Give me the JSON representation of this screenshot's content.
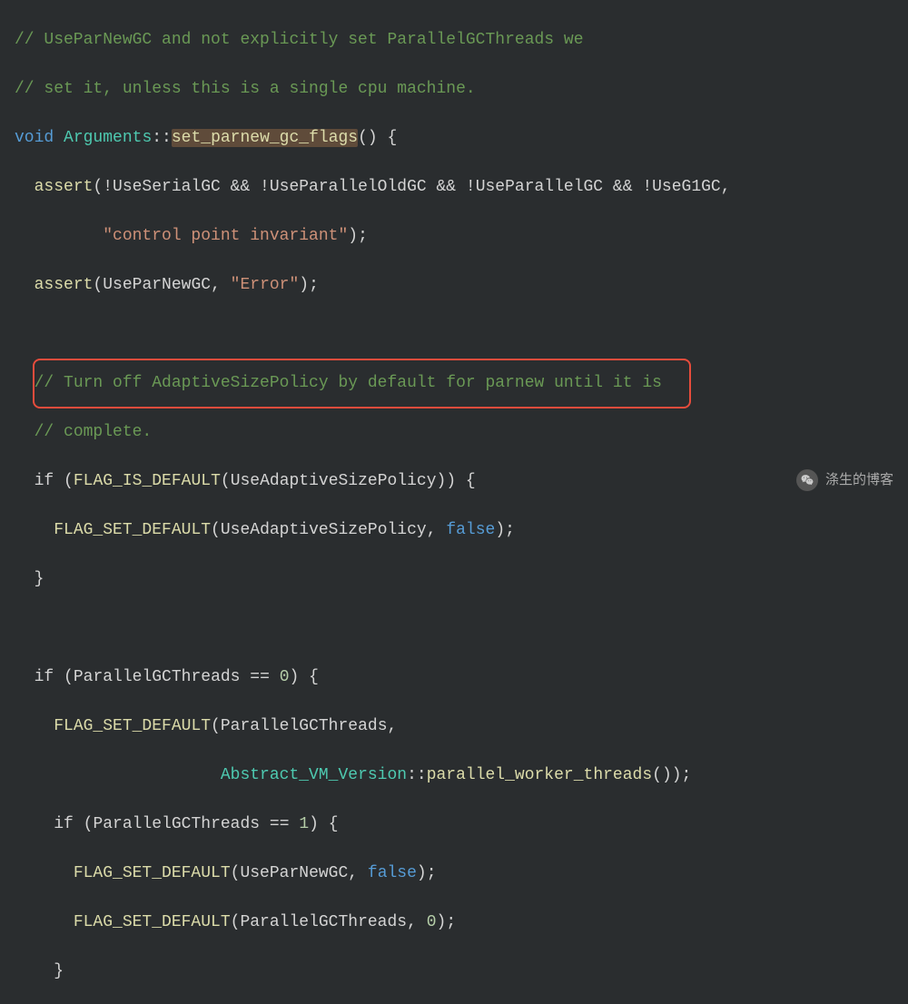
{
  "code": {
    "line1_comment": "// UseParNewGC and not explicitly set ParallelGCThreads we",
    "line2_comment": "// set it, unless this is a single cpu machine.",
    "line3_void": "void",
    "line3_class": "Arguments",
    "line3_method": "set_parnew_gc_flags",
    "line4_assert": "assert",
    "line4_expr": "(!UseSerialGC && !UseParallelOldGC && !UseParallelGC && !UseG1GC,",
    "line5_string": "\"control point invariant\"",
    "line6_assert": "assert",
    "line6_arg1": "UseParNewGC",
    "line6_string": "\"Error\"",
    "line8_comment": "// Turn off AdaptiveSizePolicy by default for parnew until it is",
    "line9_comment": "// complete.",
    "line10_if": "if",
    "line10_macro": "FLAG_IS_DEFAULT",
    "line10_arg": "UseAdaptiveSizePolicy",
    "line11_macro": "FLAG_SET_DEFAULT",
    "line11_arg": "UseAdaptiveSizePolicy",
    "line11_false": "false",
    "line14_if": "if",
    "line14_var": "ParallelGCThreads",
    "line14_zero": "0",
    "line15_macro": "FLAG_SET_DEFAULT",
    "line15_arg": "ParallelGCThreads",
    "line16_class": "Abstract_VM_Version",
    "line16_method": "parallel_worker_threads",
    "line17_if": "if",
    "line17_var": "ParallelGCThreads",
    "line17_one": "1",
    "line18_macro": "FLAG_SET_DEFAULT",
    "line18_arg": "UseParNewGC",
    "line18_false": "false",
    "line19_macro": "FLAG_SET_DEFAULT",
    "line19_arg": "ParallelGCThreads",
    "line19_zero": "0"
  },
  "watermark_text": "涤生的博客"
}
